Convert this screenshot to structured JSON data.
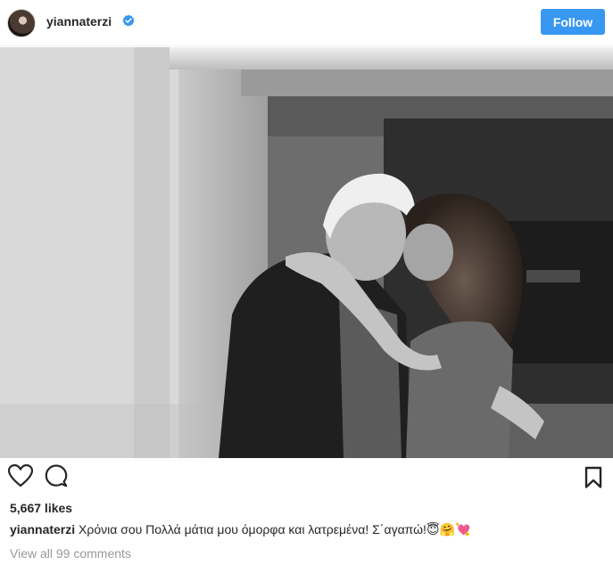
{
  "post": {
    "username": "yiannaterzi",
    "verified_icon": "verified-badge-icon",
    "follow_label": "Follow",
    "likes_text": "5,667 likes",
    "caption_username": "yiannaterzi",
    "caption_text": "Χρόνια σου Πολλά μάτια μου όμορφα και λατρεμένα! Σ΄αγαπώ!😇🤗💘",
    "comments_link": "View all 99 comments",
    "colors": {
      "follow_bg": "#3897f0",
      "verified": "#3897f0",
      "text": "#262626",
      "muted": "#999999"
    }
  },
  "actions": {
    "like_icon": "heart-icon",
    "comment_icon": "comment-icon",
    "save_icon": "bookmark-icon"
  }
}
